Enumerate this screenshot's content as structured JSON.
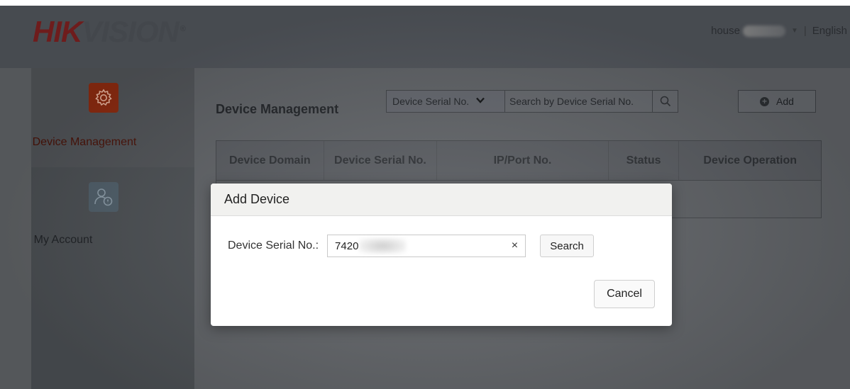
{
  "brand": {
    "logo_part1": "HIK",
    "logo_part2": "VISION",
    "logo_mark": "®"
  },
  "header": {
    "username": "house",
    "language": "English",
    "separator": "|"
  },
  "sidebar": {
    "items": [
      {
        "label": "Device Management",
        "icon": "gear-icon",
        "active": true
      },
      {
        "label": "My Account",
        "icon": "account-icon",
        "active": false
      }
    ]
  },
  "main": {
    "title": "Device Management",
    "filter": {
      "selected": "Device Serial No.",
      "placeholder": "Search by Device Serial No."
    },
    "add_label": "Add",
    "table_headers": [
      "Device Domain",
      "Device Serial No.",
      "IP/Port No.",
      "Status",
      "Device Operation"
    ]
  },
  "dialog": {
    "title": "Add Device",
    "serial_label": "Device Serial No.:",
    "serial_value": "7420",
    "clear_symbol": "×",
    "search_label": "Search",
    "cancel_label": "Cancel"
  },
  "colors": {
    "brand_red": "#c8281e",
    "accent_orange": "#e0561d"
  }
}
